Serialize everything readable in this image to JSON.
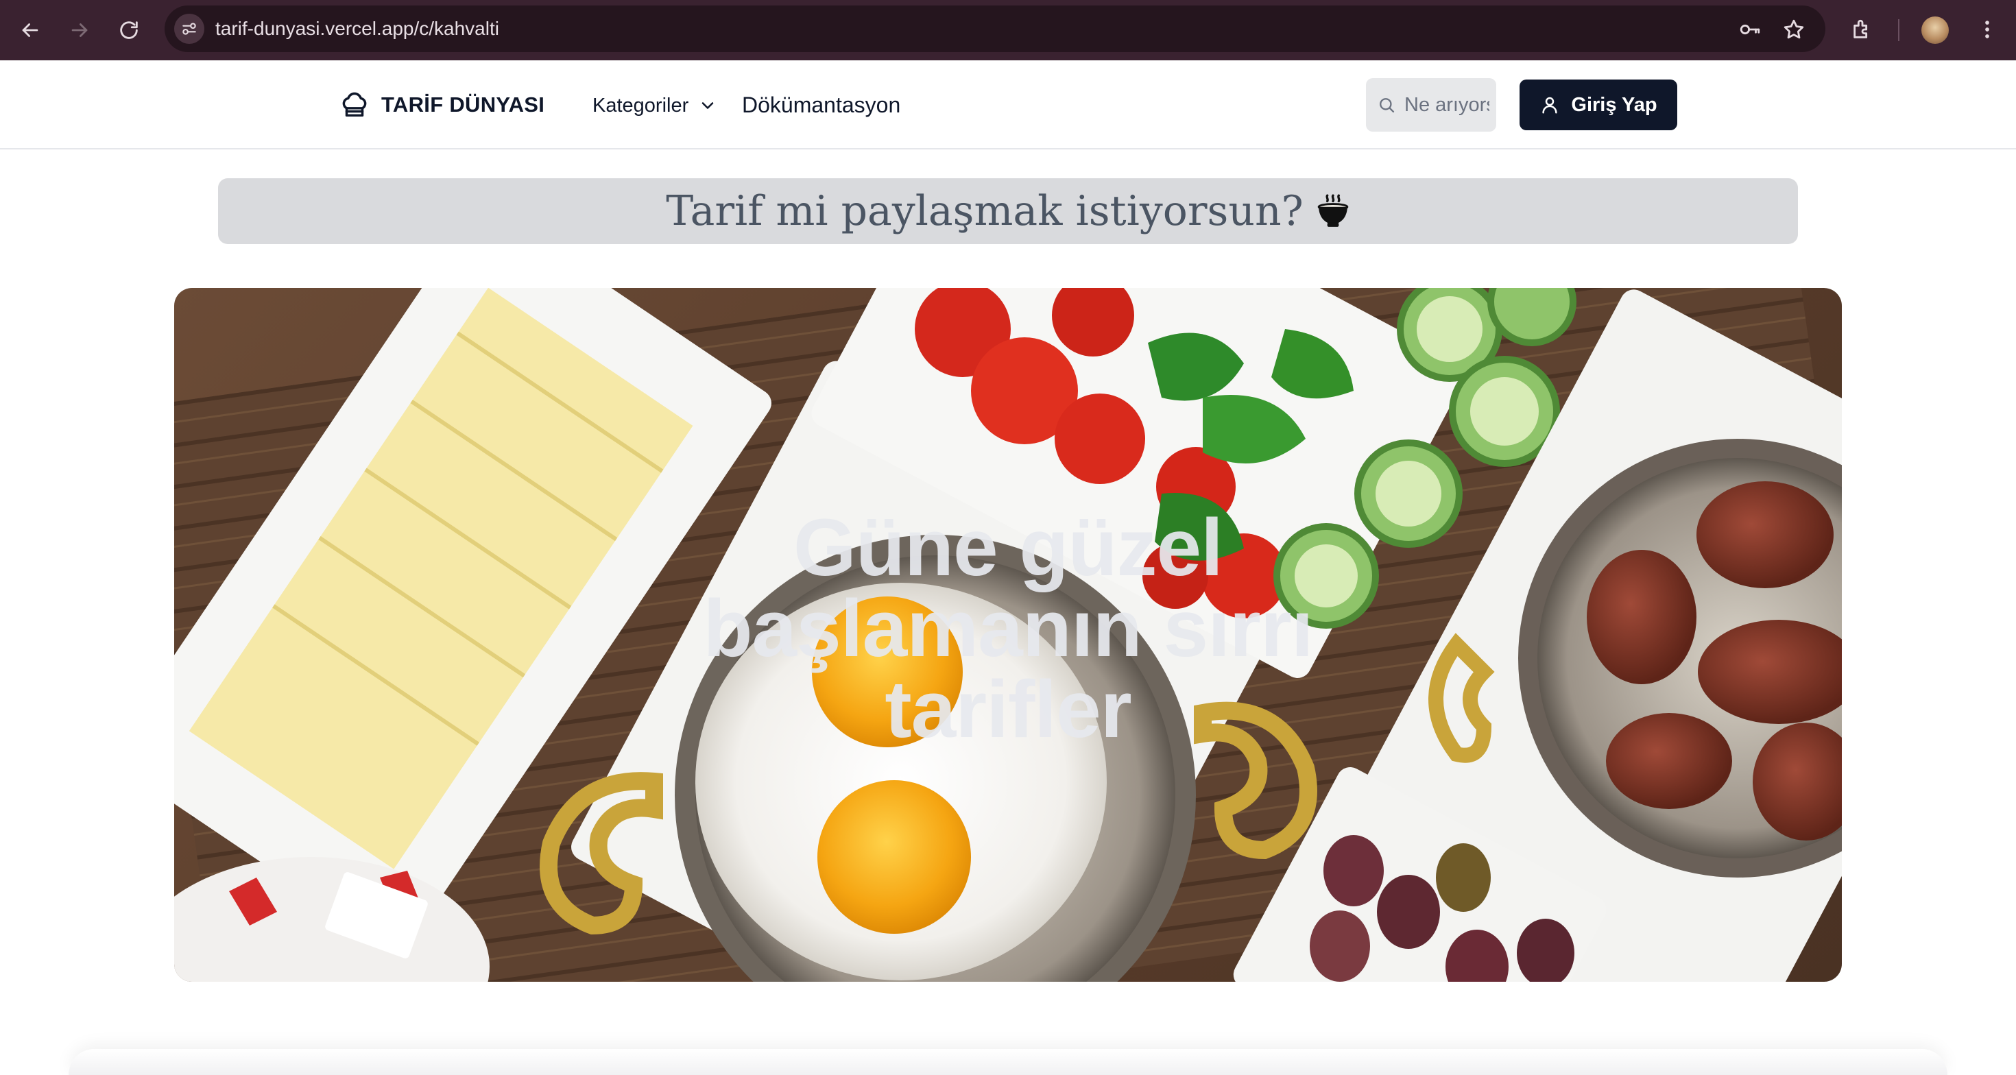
{
  "browser": {
    "url": "tarif-dunyasi.vercel.app/c/kahvalti",
    "icons": [
      "back-arrow-icon",
      "forward-arrow-icon",
      "reload-icon",
      "site-settings-icon",
      "key-icon",
      "star-icon",
      "extensions-icon",
      "profile-avatar",
      "kebab-menu-icon"
    ]
  },
  "header": {
    "logo_text": "TARİF DÜNYASI",
    "nav_categories": "Kategoriler",
    "nav_docs": "Dökümantasyon",
    "search_placeholder": "Ne arıyorsun?",
    "login_label": "Giriş Yap"
  },
  "banner": {
    "text": "Tarif mi paylaşmak istiyorsun?",
    "icon": "steaming-bowl-icon"
  },
  "hero": {
    "title": "Güne güzel başlamanın sırrı tarifler"
  },
  "colors": {
    "chrome_bg": "#3a2230",
    "omnibox_bg": "#25151e",
    "primary_button": "#0f172a",
    "banner_bg": "#d9dadd"
  }
}
